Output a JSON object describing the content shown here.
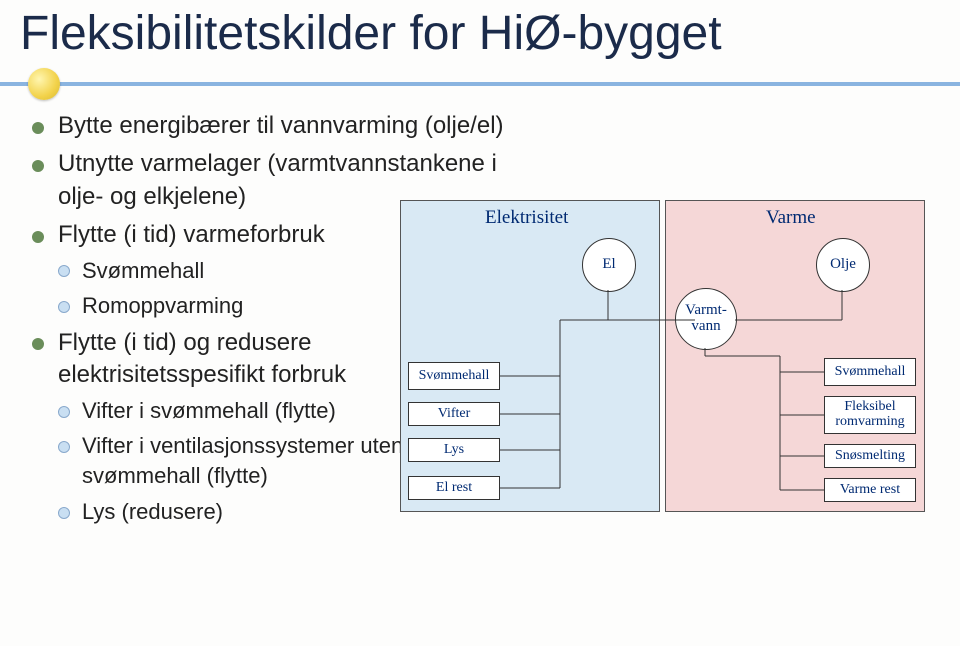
{
  "title": "Fleksibilitetskilder for HiØ-bygget",
  "bullets": {
    "b1": "Bytte energibærer til vannvarming (olje/el)",
    "b2": "Utnytte varmelager (varmtvannstankene i olje- og elkjelene)",
    "b3": "Flytte (i tid) varmeforbruk",
    "b3a": "Svømmehall",
    "b3b": "Romoppvarming",
    "b4": "Flytte (i tid) og redusere elektrisitetsspesifikt forbruk",
    "b4a": "Vifter i svømmehall (flytte)",
    "b4b": "Vifter i ventilasjonssystemer utenfor svømmehall (flytte)",
    "b4c": "Lys (redusere)"
  },
  "diagram": {
    "left_title": "Elektrisitet",
    "right_title": "Varme",
    "circle_el": "El",
    "circle_varmtvann": "Varmt-\nvann",
    "circle_olje": "Olje",
    "el_nodes": {
      "svommehall": "Svømmehall",
      "vifter": "Vifter",
      "lys": "Lys",
      "el_rest": "El rest"
    },
    "va_nodes": {
      "svommehall": "Svømmehall",
      "fleksibel": "Fleksibel\nromvarming",
      "snosmelting": "Snøsmelting",
      "varme_rest": "Varme rest"
    }
  }
}
